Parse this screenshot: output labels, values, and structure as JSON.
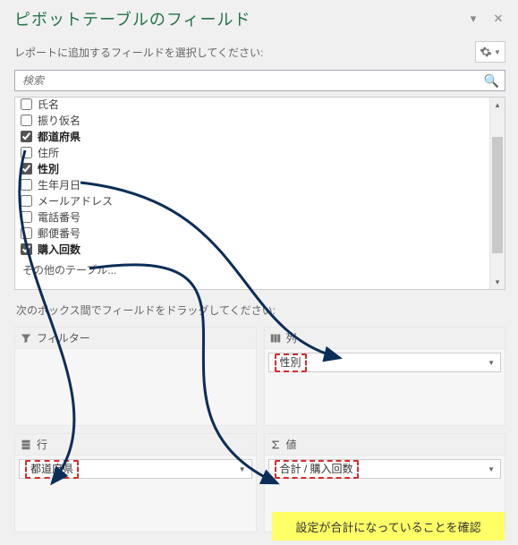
{
  "title": "ピボットテーブルのフィールド",
  "subtitle": "レポートに追加するフィールドを選択してください:",
  "search": {
    "placeholder": "検索"
  },
  "fields": [
    {
      "label": "氏名",
      "checked": false,
      "bold": false,
      "cut": true
    },
    {
      "label": "振り仮名",
      "checked": false,
      "bold": false
    },
    {
      "label": "都道府県",
      "checked": true,
      "bold": true
    },
    {
      "label": "住所",
      "checked": false,
      "bold": false
    },
    {
      "label": "性別",
      "checked": true,
      "bold": true
    },
    {
      "label": "生年月日",
      "checked": false,
      "bold": false
    },
    {
      "label": "メールアドレス",
      "checked": false,
      "bold": false
    },
    {
      "label": "電話番号",
      "checked": false,
      "bold": false
    },
    {
      "label": "郵便番号",
      "checked": false,
      "bold": false
    },
    {
      "label": "購入回数",
      "checked": true,
      "bold": true
    }
  ],
  "other_tables": "その他のテーブル...",
  "drag_label": "次のボックス間でフィールドをドラッグしてください:",
  "zones": {
    "filter": {
      "label": "フィルター"
    },
    "columns": {
      "label": "列",
      "item": "性別"
    },
    "rows": {
      "label": "行",
      "item": "都道府県"
    },
    "values": {
      "label": "値",
      "item": "合計 / 購入回数"
    }
  },
  "note": "設定が合計になっていることを確認"
}
